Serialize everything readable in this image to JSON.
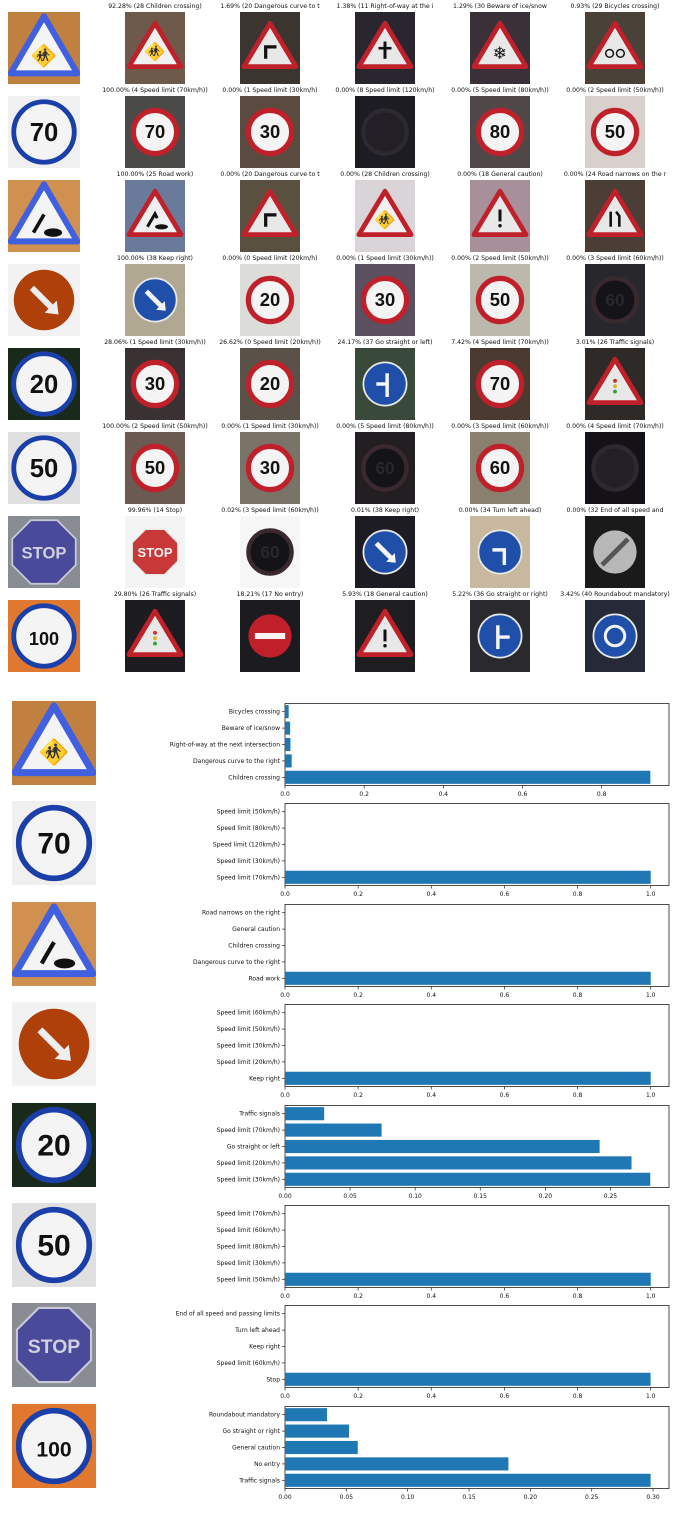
{
  "top_grid": {
    "rows": [
      {
        "query": {
          "sign": "children"
        },
        "preds": [
          {
            "caption": "92.28% (28 Children crossing)",
            "sign": "children",
            "bg": "#6d5a4a"
          },
          {
            "caption": "1.69% (20 Dangerous curve to t",
            "sign": "curve",
            "bg": "#3b3530"
          },
          {
            "caption": "1.38% (11 Right-of-way at the i",
            "sign": "rightofway",
            "bg": "#2a2630"
          },
          {
            "caption": "1.29% (30 Beware of ice/snow",
            "sign": "ice",
            "bg": "#3a3038"
          },
          {
            "caption": "0.93% (29 Bicycles crossing)",
            "sign": "bicycle",
            "bg": "#4a4238"
          }
        ]
      },
      {
        "query": {
          "sign": "70"
        },
        "preds": [
          {
            "caption": "100.00% (4 Speed limit (70km/h))",
            "sign": "70",
            "bg": "#4a4a48"
          },
          {
            "caption": "0.00% (1 Speed limit (30km/h)",
            "sign": "30",
            "bg": "#5a4a40"
          },
          {
            "caption": "0.00% (8 Speed limit (120km/h)",
            "sign": "dark",
            "bg": "#1c1c22"
          },
          {
            "caption": "0.00% (5 Speed limit (80km/h))",
            "sign": "80",
            "bg": "#504848"
          },
          {
            "caption": "0.00% (2 Speed limit (50km/h))",
            "sign": "50",
            "bg": "#d8d0cc"
          }
        ]
      },
      {
        "query": {
          "sign": "roadwork"
        },
        "preds": [
          {
            "caption": "100.00% (25 Road work)",
            "sign": "roadwork",
            "bg": "#6a7a9a"
          },
          {
            "caption": "0.00% (20 Dangerous curve to t",
            "sign": "curve",
            "bg": "#5a5040"
          },
          {
            "caption": "0.00% (28 Children crossing)",
            "sign": "children",
            "bg": "#d8d4d8"
          },
          {
            "caption": "0.00% (18 General caution)",
            "sign": "caution",
            "bg": "#a8909a"
          },
          {
            "caption": "0.00% (24 Road narrows on the r",
            "sign": "narrows",
            "bg": "#4a3e36"
          }
        ]
      },
      {
        "query": {
          "sign": "keepright"
        },
        "preds": [
          {
            "caption": "100.00% (38 Keep right)",
            "sign": "keepright",
            "bg": "#b0a890"
          },
          {
            "caption": "0.00% (0 Speed limit (20km/h)",
            "sign": "20",
            "bg": "#dcdcd8"
          },
          {
            "caption": "0.00% (1 Speed limit (30km/h))",
            "sign": "30",
            "bg": "#5a5060"
          },
          {
            "caption": "0.00% (2 Speed limit (50km/h))",
            "sign": "50",
            "bg": "#bcb8ac"
          },
          {
            "caption": "0.00% (3 Speed limit (60km/h))",
            "sign": "darkround",
            "bg": "#28282c"
          }
        ]
      },
      {
        "query": {
          "sign": "20"
        },
        "preds": [
          {
            "caption": "28.06% (1 Speed limit (30km/h))",
            "sign": "30",
            "bg": "#3a3232"
          },
          {
            "caption": "26.62% (0 Speed limit (20km/h))",
            "sign": "20",
            "bg": "#5a5248"
          },
          {
            "caption": "24.17% (37 Go straight or left)",
            "sign": "straightleft",
            "bg": "#3a4a3a"
          },
          {
            "caption": "7.42% (4 Speed limit (70km/h))",
            "sign": "70",
            "bg": "#4a3a30"
          },
          {
            "caption": "3.01% (26 Traffic signals)",
            "sign": "traffic",
            "bg": "#2e2a28"
          }
        ]
      },
      {
        "query": {
          "sign": "50"
        },
        "preds": [
          {
            "caption": "100.00% (2 Speed limit (50km/h))",
            "sign": "50",
            "bg": "#6a5a50"
          },
          {
            "caption": "0.00% (1 Speed limit (30km/h))",
            "sign": "30",
            "bg": "#7a7468"
          },
          {
            "caption": "0.00% (5 Speed limit (80km/h))",
            "sign": "darkround",
            "bg": "#221e22"
          },
          {
            "caption": "0.00% (3 Speed limit (60km/h))",
            "sign": "60",
            "bg": "#8a8070"
          },
          {
            "caption": "0.00% (4 Speed limit (70km/h))",
            "sign": "dark",
            "bg": "#141216"
          }
        ]
      },
      {
        "query": {
          "sign": "stop"
        },
        "preds": [
          {
            "caption": "99.96% (14 Stop)",
            "sign": "stop",
            "bg": "#f4f4f4"
          },
          {
            "caption": "0.02% (3 Speed limit (60km/h))",
            "sign": "darkround",
            "bg": "#f6f6f6"
          },
          {
            "caption": "0.01% (38 Keep right)",
            "sign": "keepright",
            "bg": "#1c1c22"
          },
          {
            "caption": "0.00% (34 Turn left ahead)",
            "sign": "turnleft",
            "bg": "#c8b8a0"
          },
          {
            "caption": "0.00% (32 End of all speed and",
            "sign": "endall",
            "bg": "#1a1a1a"
          }
        ]
      },
      {
        "query": {
          "sign": "100"
        },
        "preds": [
          {
            "caption": "29.80% (26 Traffic signals)",
            "sign": "traffic",
            "bg": "#1c1c20"
          },
          {
            "caption": "18.21% (17 No entry)",
            "sign": "noentry",
            "bg": "#1c1c20"
          },
          {
            "caption": "5.93% (18 General caution)",
            "sign": "caution",
            "bg": "#1e1e20"
          },
          {
            "caption": "5.22% (36 Go straight or right)",
            "sign": "straightright",
            "bg": "#2a2a2e"
          },
          {
            "caption": "3.42% (40 Roundabout mandatory)",
            "sign": "roundabout",
            "bg": "#262a38"
          }
        ]
      }
    ]
  },
  "colors": {
    "bar": "#1f77b4",
    "sign_red": "#c0202a",
    "sign_blue": "#1a3fa8",
    "axis": "#222222"
  },
  "chart_data": [
    {
      "type": "bar",
      "orientation": "horizontal",
      "query_sign": "children",
      "categories": [
        "Children crossing",
        "Dangerous curve to the right",
        "Right-of-way at the next intersection",
        "Beware of ice/snow",
        "Bicycles crossing"
      ],
      "values": [
        0.9228,
        0.0169,
        0.0138,
        0.0129,
        0.0093
      ],
      "xlim": [
        0,
        0.97
      ],
      "xticks": [
        "0.0",
        "0.2",
        "0.4",
        "0.6",
        "0.8"
      ],
      "xtick_values": [
        0,
        0.2,
        0.4,
        0.6,
        0.8
      ]
    },
    {
      "type": "bar",
      "orientation": "horizontal",
      "query_sign": "70",
      "categories": [
        "Speed limit (70km/h)",
        "Speed limit (30km/h)",
        "Speed limit (120km/h)",
        "Speed limit (80km/h)",
        "Speed limit (50km/h)"
      ],
      "values": [
        1.0,
        0.0,
        0.0,
        0.0,
        0.0
      ],
      "xlim": [
        0,
        1.05
      ],
      "xticks": [
        "0.0",
        "0.2",
        "0.4",
        "0.6",
        "0.8",
        "1.0"
      ],
      "xtick_values": [
        0,
        0.2,
        0.4,
        0.6,
        0.8,
        1.0
      ]
    },
    {
      "type": "bar",
      "orientation": "horizontal",
      "query_sign": "roadwork",
      "categories": [
        "Road work",
        "Dangerous curve to the right",
        "Children crossing",
        "General caution",
        "Road narrows on the right"
      ],
      "values": [
        1.0,
        0.0,
        0.0,
        0.0,
        0.0
      ],
      "xlim": [
        0,
        1.05
      ],
      "xticks": [
        "0.0",
        "0.2",
        "0.4",
        "0.6",
        "0.8",
        "1.0"
      ],
      "xtick_values": [
        0,
        0.2,
        0.4,
        0.6,
        0.8,
        1.0
      ]
    },
    {
      "type": "bar",
      "orientation": "horizontal",
      "query_sign": "keepright",
      "categories": [
        "Keep right",
        "Speed limit (20km/h)",
        "Speed limit (30km/h)",
        "Speed limit (50km/h)",
        "Speed limit (60km/h)"
      ],
      "values": [
        1.0,
        0.0,
        0.0,
        0.0,
        0.0
      ],
      "xlim": [
        0,
        1.05
      ],
      "xticks": [
        "0.0",
        "0.2",
        "0.4",
        "0.6",
        "0.8",
        "1.0"
      ],
      "xtick_values": [
        0,
        0.2,
        0.4,
        0.6,
        0.8,
        1.0
      ]
    },
    {
      "type": "bar",
      "orientation": "horizontal",
      "query_sign": "20",
      "categories": [
        "Speed limit (30km/h)",
        "Speed limit (20km/h)",
        "Go straight or left",
        "Speed limit (70km/h)",
        "Traffic signals"
      ],
      "values": [
        0.2806,
        0.2662,
        0.2417,
        0.0742,
        0.0301
      ],
      "xlim": [
        0,
        0.295
      ],
      "xticks": [
        "0.00",
        "0.05",
        "0.10",
        "0.15",
        "0.20",
        "0.25"
      ],
      "xtick_values": [
        0,
        0.05,
        0.1,
        0.15,
        0.2,
        0.25
      ]
    },
    {
      "type": "bar",
      "orientation": "horizontal",
      "query_sign": "50",
      "categories": [
        "Speed limit (50km/h)",
        "Speed limit (30km/h)",
        "Speed limit (80km/h)",
        "Speed limit (60km/h)",
        "Speed limit (70km/h)"
      ],
      "values": [
        1.0,
        0.0,
        0.0,
        0.0,
        0.0
      ],
      "xlim": [
        0,
        1.05
      ],
      "xticks": [
        "0.0",
        "0.2",
        "0.4",
        "0.6",
        "0.8",
        "1.0"
      ],
      "xtick_values": [
        0,
        0.2,
        0.4,
        0.6,
        0.8,
        1.0
      ]
    },
    {
      "type": "bar",
      "orientation": "horizontal",
      "query_sign": "stop",
      "categories": [
        "Stop",
        "Speed limit (60km/h)",
        "Keep right",
        "Turn left ahead",
        "End of all speed and passing limits"
      ],
      "values": [
        0.9996,
        0.0002,
        0.0001,
        0.0,
        0.0
      ],
      "xlim": [
        0,
        1.05
      ],
      "xticks": [
        "0.0",
        "0.2",
        "0.4",
        "0.6",
        "0.8",
        "1.0"
      ],
      "xtick_values": [
        0,
        0.2,
        0.4,
        0.6,
        0.8,
        1.0
      ]
    },
    {
      "type": "bar",
      "orientation": "horizontal",
      "query_sign": "100",
      "categories": [
        "Traffic signals",
        "No entry",
        "General caution",
        "Go straight or right",
        "Roundabout mandatory"
      ],
      "values": [
        0.298,
        0.1821,
        0.0593,
        0.0522,
        0.0342
      ],
      "xlim": [
        0,
        0.313
      ],
      "xticks": [
        "0.00",
        "0.05",
        "0.10",
        "0.15",
        "0.20",
        "0.25",
        "0.30"
      ],
      "xtick_values": [
        0,
        0.05,
        0.1,
        0.15,
        0.2,
        0.25,
        0.3
      ]
    }
  ]
}
